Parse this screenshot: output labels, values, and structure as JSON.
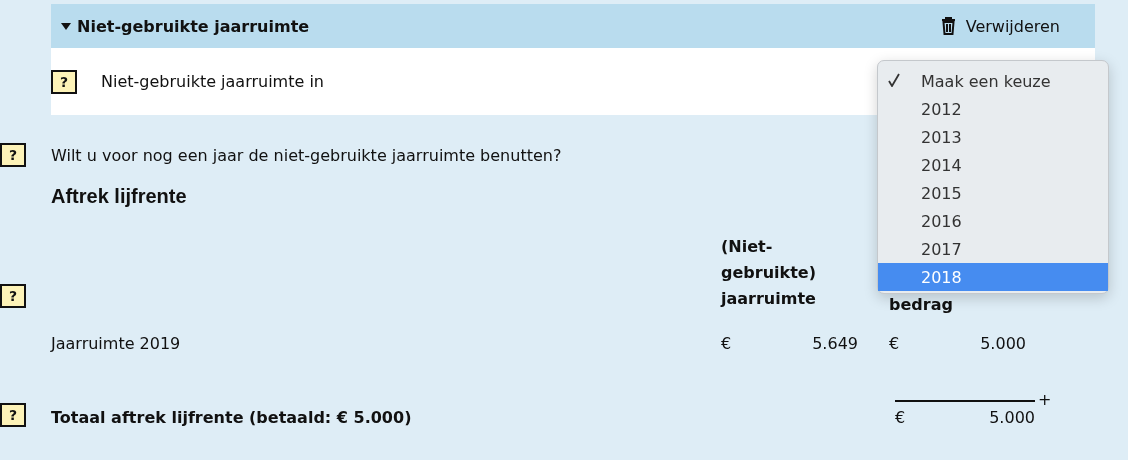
{
  "section": {
    "title": "Niet-gebruikte jaarruimte",
    "expanded": true,
    "delete_label": "Verwijderen",
    "field": {
      "help": "?",
      "label": "Niet-gebruikte jaarruimte in"
    }
  },
  "dropdown": {
    "options": [
      {
        "label": "Maak een keuze",
        "checked": true,
        "selected": false
      },
      {
        "label": "2012",
        "checked": false,
        "selected": false
      },
      {
        "label": "2013",
        "checked": false,
        "selected": false
      },
      {
        "label": "2014",
        "checked": false,
        "selected": false
      },
      {
        "label": "2015",
        "checked": false,
        "selected": false
      },
      {
        "label": "2016",
        "checked": false,
        "selected": false
      },
      {
        "label": "2017",
        "checked": false,
        "selected": false
      },
      {
        "label": "2018",
        "checked": false,
        "selected": true
      }
    ]
  },
  "question": {
    "help": "?",
    "text": "Wilt u voor nog een jaar de niet-gebruikte jaarruimte benutten?"
  },
  "heading": "Aftrek lijfrente",
  "table": {
    "help": "?",
    "columns": [
      "(Niet-gebruikte) jaarruimte",
      "bedrag"
    ],
    "rows": [
      {
        "label": "Jaarruimte 2019",
        "values": [
          {
            "currency": "€",
            "amount": "5.649"
          },
          {
            "currency": "€",
            "amount": "5.000"
          }
        ]
      }
    ]
  },
  "total": {
    "help": "?",
    "label": "Totaal aftrek lijfrente (betaald: € 5.000)",
    "currency": "€",
    "amount": "5.000",
    "operator": "+"
  }
}
